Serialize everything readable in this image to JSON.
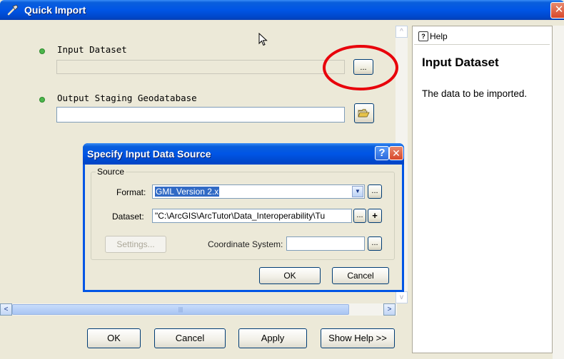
{
  "window": {
    "title": "Quick Import",
    "close_glyph": "✕"
  },
  "form": {
    "input_dataset_label": "Input Dataset",
    "input_dataset_value": "",
    "browse_button_label": "...",
    "output_label": "Output Staging Geodatabase",
    "output_value": "",
    "folder_icon": "open-folder-icon"
  },
  "scrollbars": {
    "up_arrow": "^",
    "down_arrow": "v",
    "left_arrow": "<",
    "right_arrow": ">",
    "thumb_grip": "|||"
  },
  "buttons": {
    "ok": "OK",
    "cancel": "Cancel",
    "apply": "Apply",
    "show_help": "Show Help >>"
  },
  "help": {
    "tab_icon": "?",
    "tab_label": "Help",
    "heading": "Input Dataset",
    "text": "The data to be imported."
  },
  "dialog": {
    "title": "Specify Input Data Source",
    "help_glyph": "?",
    "close_glyph": "✕",
    "group_label": "Source",
    "format_label": "Format:",
    "format_value": "GML Version 2.x",
    "format_browse": "...",
    "dataset_label": "Dataset:",
    "dataset_value": "\"C:\\ArcGIS\\ArcTutor\\Data_Interoperability\\Tu",
    "dataset_browse": "...",
    "dataset_add": "+",
    "settings_label": "Settings...",
    "coord_label": "Coordinate System:",
    "coord_value": "",
    "coord_browse": "...",
    "ok": "OK",
    "cancel": "Cancel"
  },
  "colors": {
    "title_blue": "#0055e5",
    "window_bg": "#ece9d8",
    "highlight_red": "#e8000b",
    "bullet_green": "#4cb64c"
  }
}
